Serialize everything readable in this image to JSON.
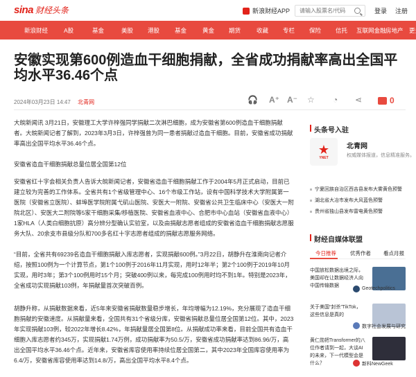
{
  "header": {
    "logo": "sina",
    "logo_sub": "财经头条",
    "app_link": "新浪财经APP",
    "search_placeholder": "请输入股票名/代码",
    "login": "登录",
    "register": "注册"
  },
  "nav": {
    "items": [
      "新浪财经",
      "A股",
      "基金",
      "美股",
      "港股",
      "基金",
      "黄金",
      "期货",
      "收藏",
      "专栏",
      "保险",
      "信托",
      "互联网金融",
      "房地产",
      "更多"
    ]
  },
  "article": {
    "title": "安徽实现第600例造血干细胞捐献，全省成功捐献率高出全国平均水平36.46个点",
    "date": "2024年03月23日 14:47",
    "source": "北青网",
    "comment_count": "0",
    "paragraphs": [
      "大皖新闻讯 3月21日，安徽理工大学许梓强同学捐献二次淋巴细胞，成为安徽省第600例造血干细胞捐献者。大皖新闻记者了解到，2023年3月3日，许梓强曾为同一患者捐献过造血干细胞。目前，安徽省成功捐献率高出全国平均水平36.46个点。",
      "安徽省造血干细胞捐献总量位居全国第12位",
      "安徽省红十字会相关负责人告诉大皖新闻记者，安徽省造血干细胞捐献工作于2004年5月正式启动，目前已建立较为完善的工作体系。全省共有1个省级管理中心、16个市级工作站，设有中国科学技术大学附属第一医院（安徽省立医院）、蚌埠医学院附属弋矶山医院、安医大一附院、安徽省公共卫生临床中心（安医大一附院北区）、安医大二附院等5家干细胞采集/移植医院、安徽省血液中心、合肥市中心血站（安徽省血液中心）1家HLA（人类白细胞抗原）高分辨分型确认实验室，以及由捐献志愿者组成的安徽省造血干细胞捐献志愿服务大队、20余支市县级分队和700多名红十字志愿者组成的捐献志愿服务网络。",
      "“目前，全省共有69239名造血干细胞捐献入库志愿者，实现捐献600例。”3月22日，胡静升在淮南向记者介绍，按照100例为一个计算节点，第1个100例于2016年11月实现，用时12年半；第2个100例于2019年10月实现，用时3年；第3个100例用时15个月；突破400例以来，每完成100例用时均不到1年。特别是2023年，全省成功实现捐献103例，年捐献量首次突破百例。",
      "胡静升称，从捐献数据来看，近5年来安徽省捐献数量稳步增长，年均增幅为12.19%，充分展现了造血干细胞捐献的安徽速度。从捐献量来看，全国共有31个省级分库，安徽省捐献总量位居全国第12位。其中，2023年实现捐献103例，较2022年增长8.42%，年捐献量居全国第8位。从捐献成功率来看，目前全国共有造血干细胞入库志愿者约345万，实现捐献1.74万例，成功捐献率为50.5/万，安徽省成功捐献率达到86.96/万，高出全国平均水平36.46个点。近年来，安徽省库容使用率持续位居全国第二，其中2023年全国库容使用率为6.4/万，安徽省库容使用率达到14.8/万，高出全国平均水平8.4个点。"
    ]
  },
  "sidebar": {
    "follow_title": "头条号入驻",
    "account_name": "北青网",
    "account_logo_text": "YNET",
    "account_desc": "权威媒体报道，信息精准服务。",
    "related": [
      "宁夏回族自治区西吉县发布大雾黄色预警",
      "湖北省大冶市发布大风蓝色预警",
      "贵州省独山县发布雷电黄色预警"
    ],
    "media_title": "财经自媒体联盟",
    "tabs": [
      "今日推荐",
      "优秀作者",
      "看点月报"
    ],
    "feed": [
      {
        "title": "中国放松数据出境之际，美国却在让数据经济人向中国传输数据",
        "author": "Geotechpolitics",
        "thumb_color": "#4a6f94",
        "fav_color": "#2b4a6f"
      },
      {
        "title": "关于美国“封杀”TikTok，这些信息是真的",
        "author": "数字社会发展与研究",
        "thumb_color": "#b9c4d6",
        "fav_color": "#5a7ab8"
      },
      {
        "title": "黄仁勋把Transformer的八位作者请到一起，大谈AI的未来，下一代模型会是什么？",
        "author": "新科NewGeek",
        "thumb_color": "#2e2e3a",
        "fav_color": "#d33"
      }
    ]
  },
  "colors": {
    "brand_red": "#e2231a",
    "nav_red": "#e84a3f"
  }
}
